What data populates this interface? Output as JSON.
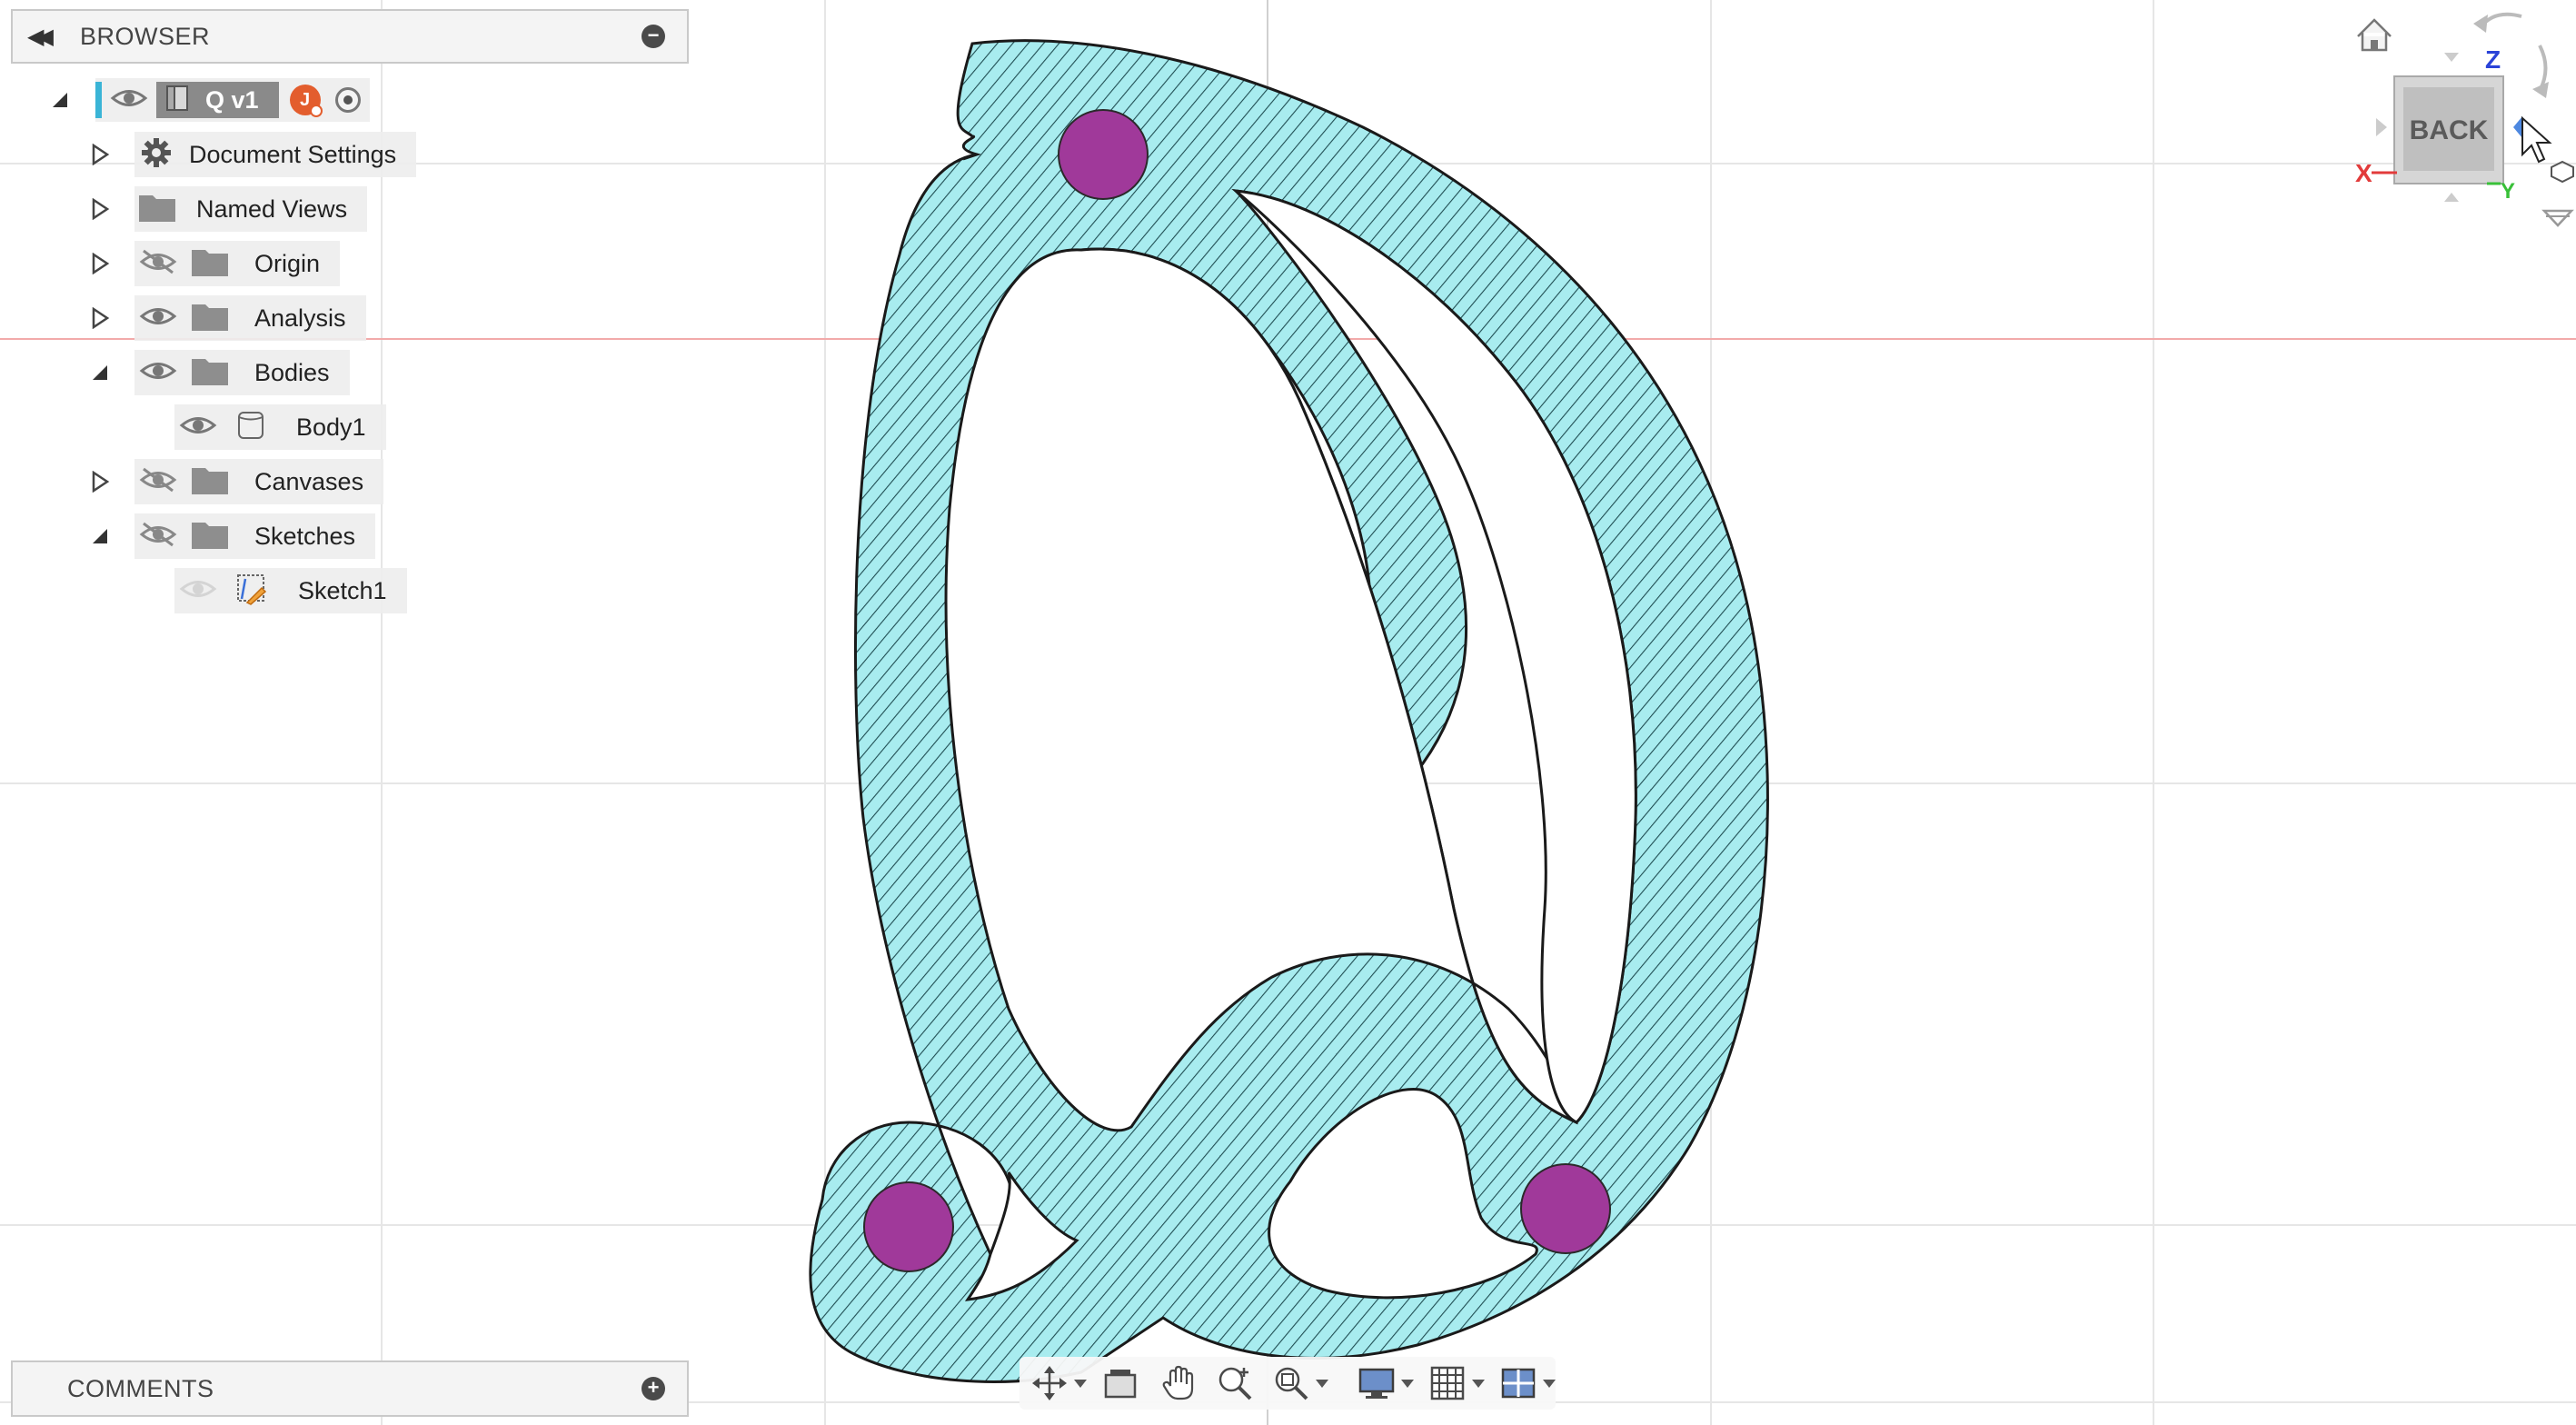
{
  "browser": {
    "title": "BROWSER",
    "root": {
      "name": "Q v1",
      "avatar_initial": "J"
    },
    "items": [
      {
        "label": "Document Settings",
        "icon": "gear-icon",
        "visibility": "none",
        "expanded": false
      },
      {
        "label": "Named Views",
        "icon": "folder-icon",
        "visibility": "none",
        "expanded": false
      },
      {
        "label": "Origin",
        "icon": "folder-icon",
        "visibility": "hidden",
        "expanded": false
      },
      {
        "label": "Analysis",
        "icon": "folder-icon",
        "visibility": "visible",
        "expanded": false
      },
      {
        "label": "Bodies",
        "icon": "folder-icon",
        "visibility": "visible",
        "expanded": true
      },
      {
        "label": "Body1",
        "icon": "body-icon",
        "visibility": "visible",
        "expanded": null
      },
      {
        "label": "Canvases",
        "icon": "folder-icon",
        "visibility": "hidden",
        "expanded": false
      },
      {
        "label": "Sketches",
        "icon": "folder-icon",
        "visibility": "hidden",
        "expanded": true
      },
      {
        "label": "Sketch1",
        "icon": "sketch-icon",
        "visibility": "dim",
        "expanded": null
      }
    ]
  },
  "comments": {
    "title": "COMMENTS"
  },
  "viewcube": {
    "face": "BACK",
    "axis_x": "X",
    "axis_y": "Y",
    "axis_z": "Z"
  },
  "toolbar": {
    "tools": [
      "orbit-icon",
      "look-at-icon",
      "pan-icon",
      "zoom-icon",
      "fit-icon",
      "display-settings-icon",
      "grid-icon",
      "viewports-icon"
    ]
  },
  "colors": {
    "body_fill": "#a8ecef",
    "hatch": "#1f4d52",
    "hole_fill": "#a0399a",
    "grid_line": "#e3e3e3",
    "axis_red": "#f2aaaa",
    "accent": "#3ab4d6"
  }
}
